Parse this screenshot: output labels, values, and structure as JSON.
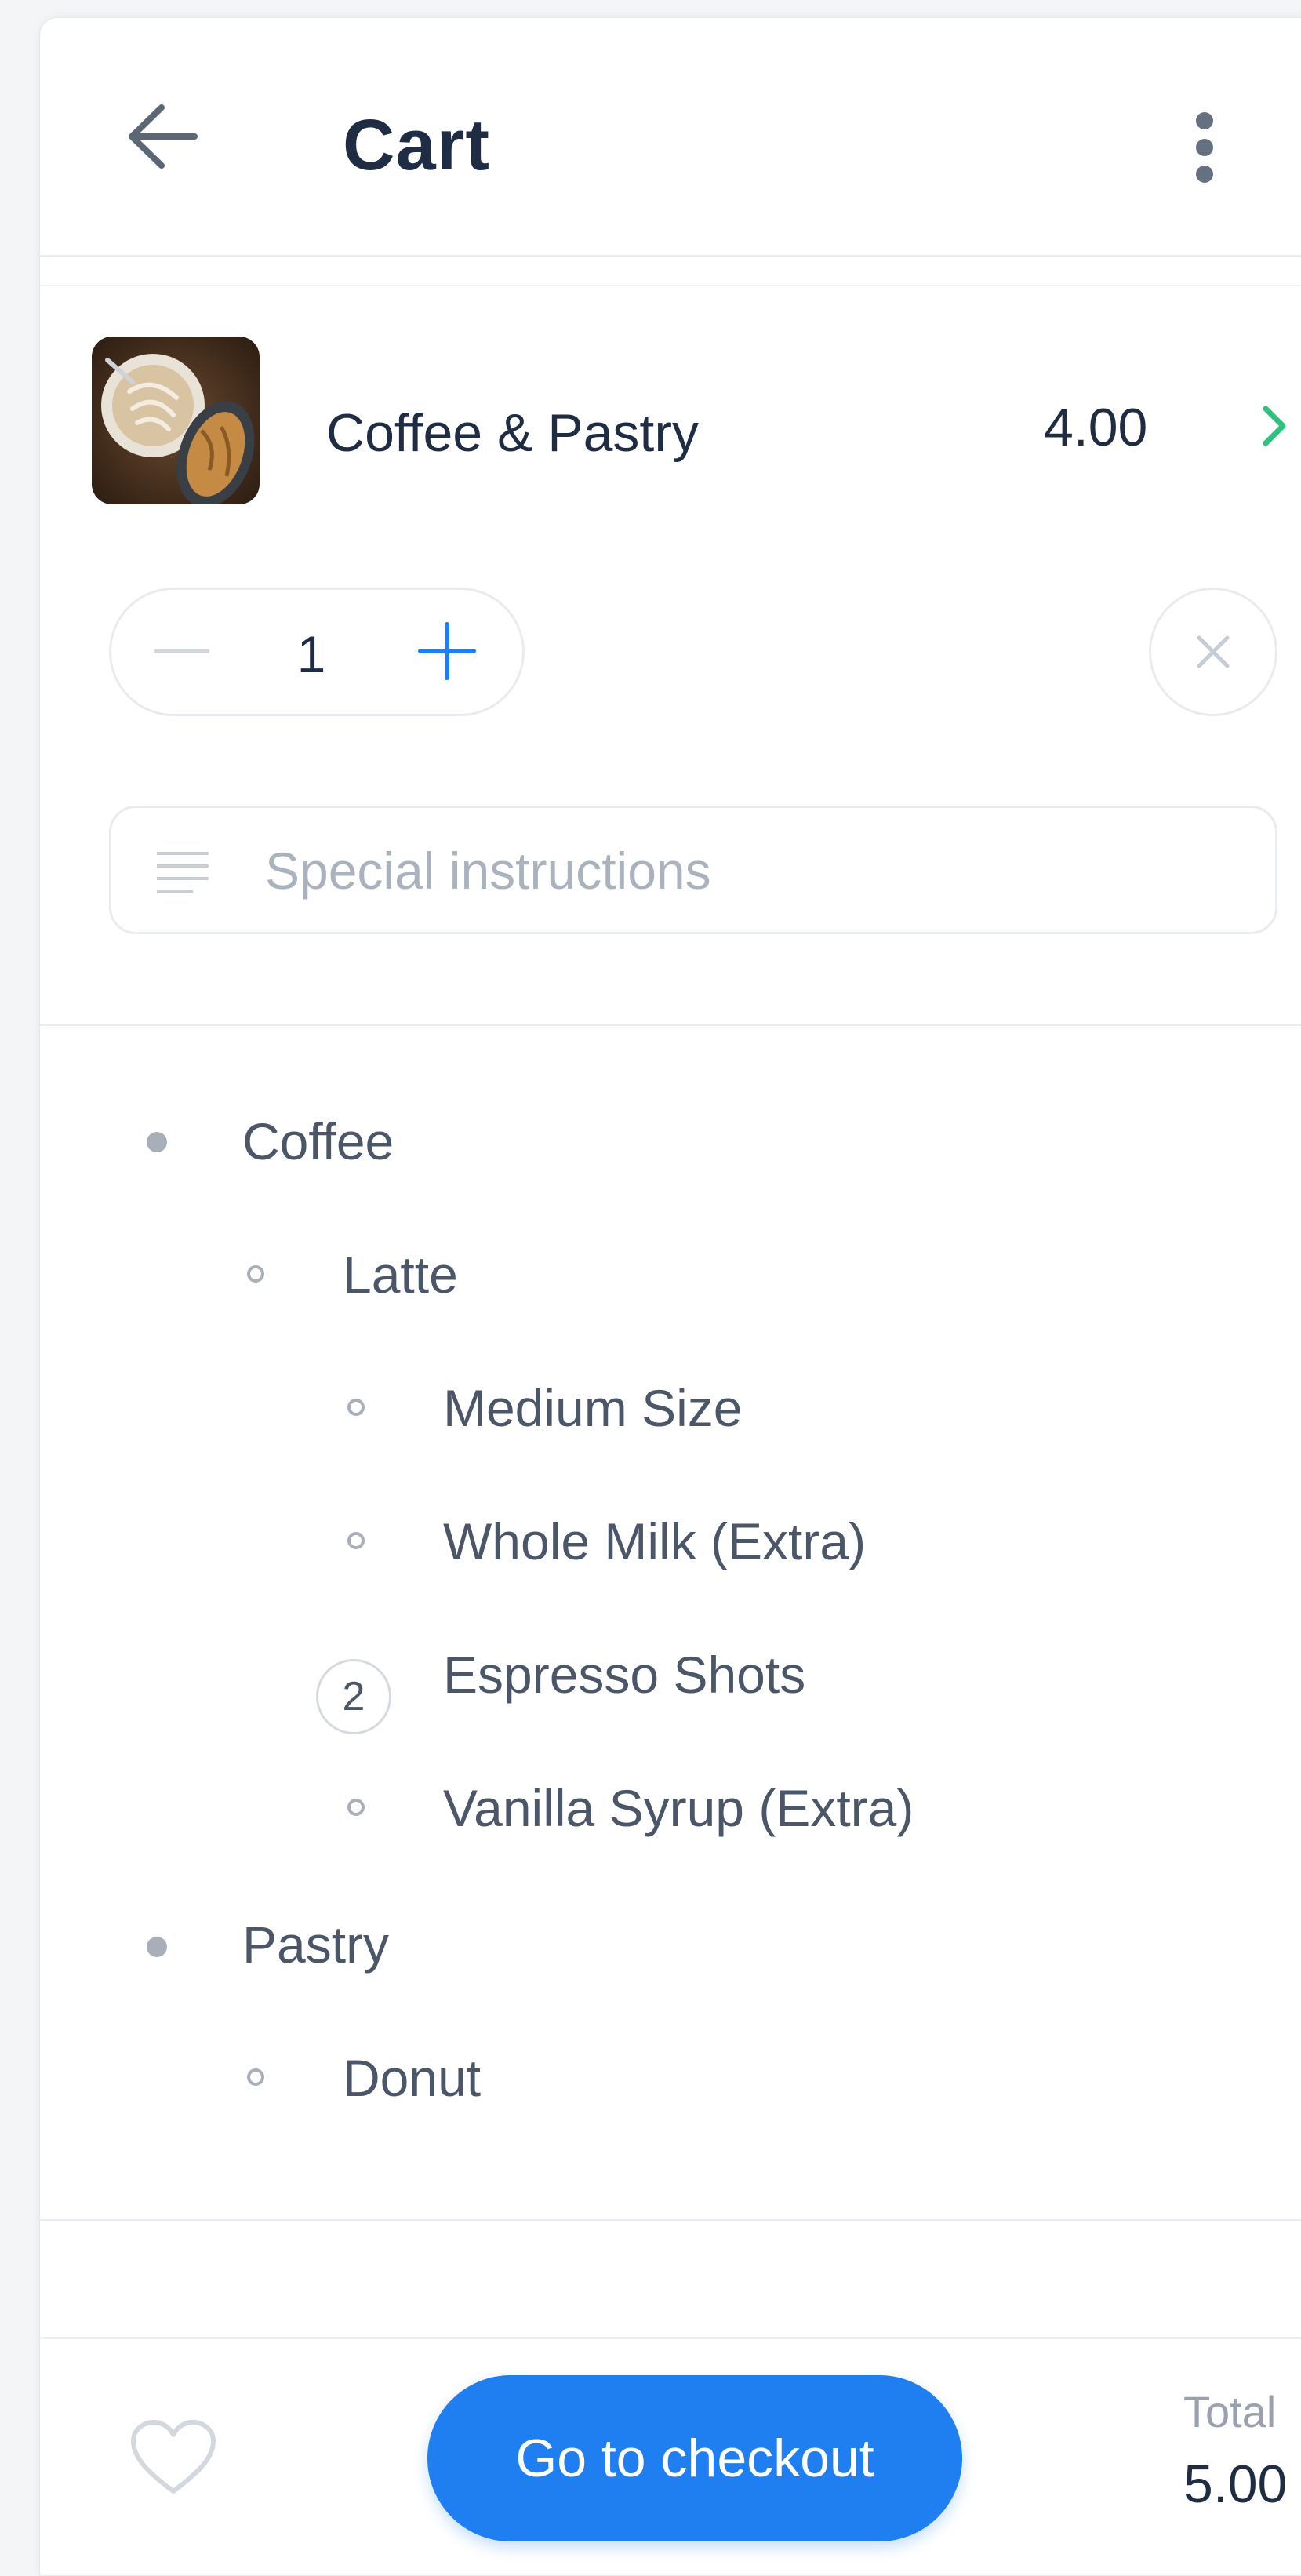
{
  "header": {
    "title": "Cart"
  },
  "item": {
    "name": "Coffee & Pastry",
    "price": "4.00",
    "quantity": "1"
  },
  "instructions": {
    "placeholder": "Special instructions"
  },
  "options": {
    "group_coffee": "Coffee",
    "latte": "Latte",
    "medium_size": "Medium Size",
    "whole_milk": "Whole Milk (Extra)",
    "espresso_count": "2",
    "espresso_shots": "Espresso Shots",
    "vanilla_syrup": "Vanilla Syrup (Extra)",
    "group_pastry": "Pastry",
    "donut": "Donut"
  },
  "footer": {
    "checkout_label": "Go to checkout",
    "total_label": "Total",
    "total_value": "5.00"
  },
  "colors": {
    "accent": "#1f7ef0",
    "chevron": "#2ec27e",
    "title": "#1f2d44"
  }
}
